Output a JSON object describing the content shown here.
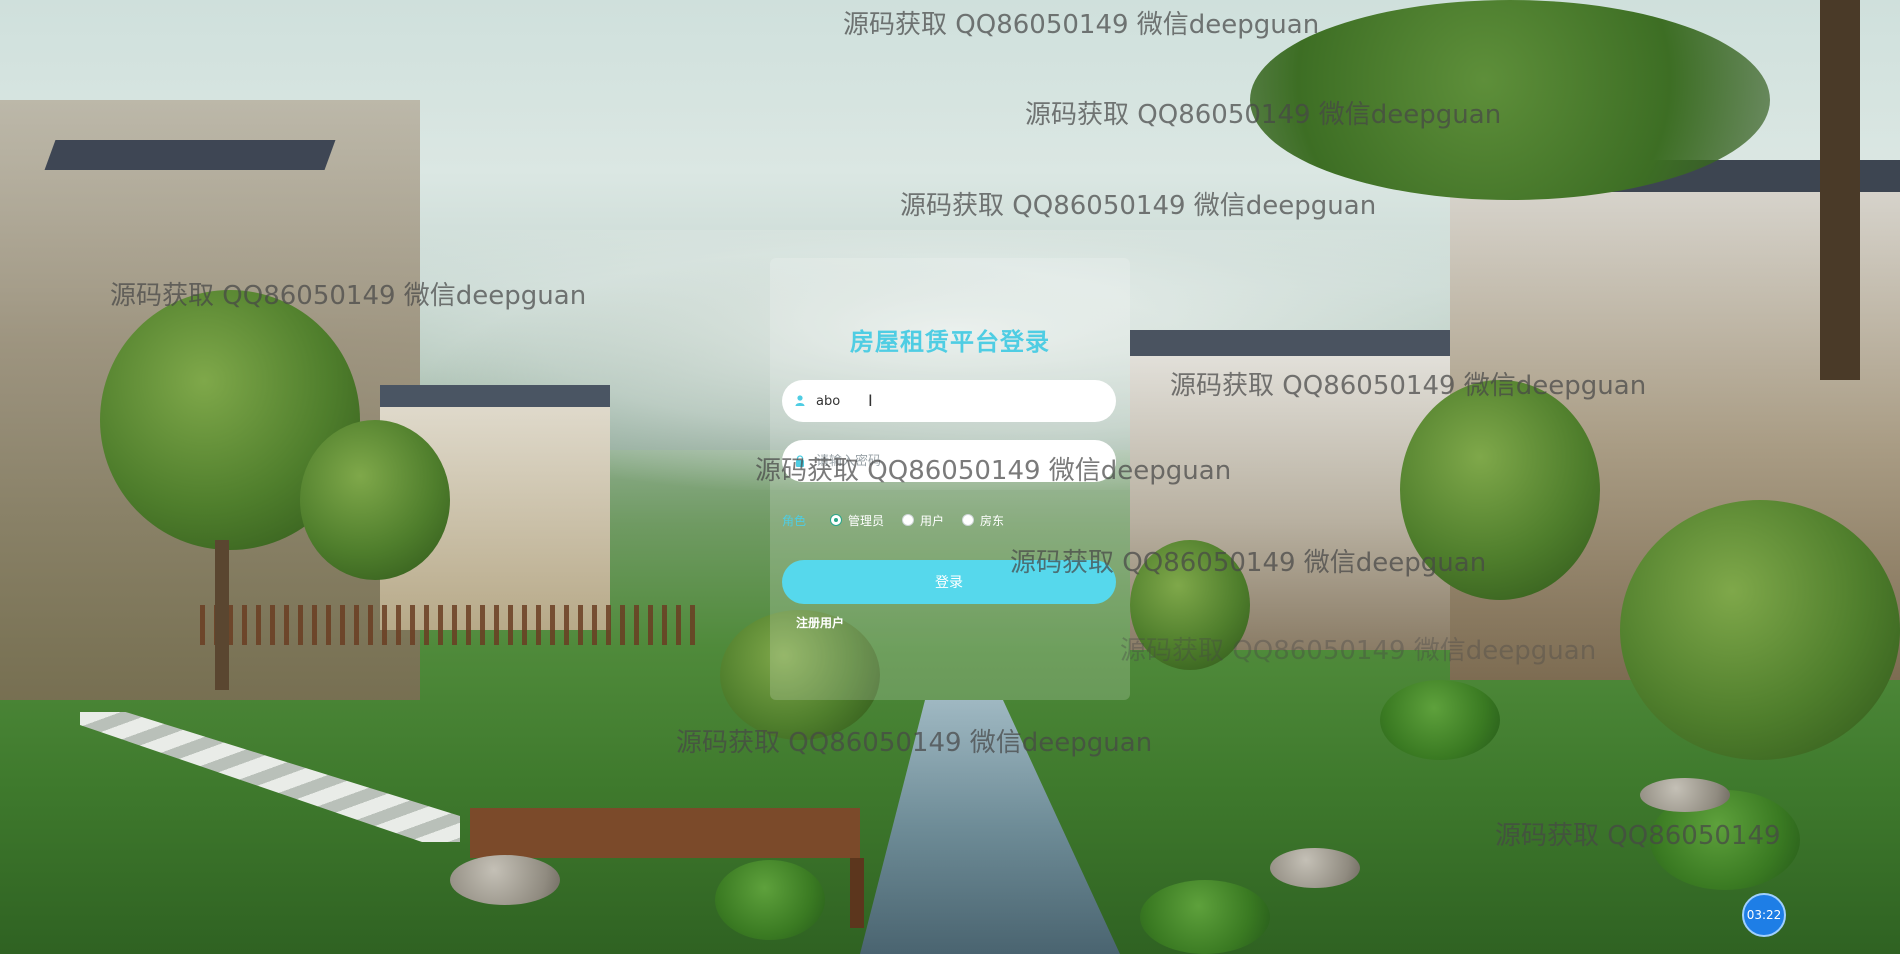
{
  "login": {
    "title": "房屋租赁平台登录",
    "username_value": "abo",
    "password_placeholder": "请输入密码",
    "role_label": "角色",
    "roles": [
      "管理员",
      "用户",
      "房东"
    ],
    "selected_role": "管理员",
    "submit_label": "登录",
    "register_label": "注册用户"
  },
  "watermarks": [
    "源码获取 QQ86050149 微信deepguan",
    "源码获取 QQ86050149 微信deepguan",
    "源码获取 QQ86050149 微信deepguan",
    "源码获取 QQ86050149 微信deepguan",
    "源码获取 QQ86050149 微信deepguan",
    "源码获取 QQ86050149 微信deepguan",
    "源码获取 QQ86050149 微信deepguan",
    "源码获取 QQ86050149 微信deepguan",
    "源码获取 QQ86050149 微信deepguan",
    "源码获取 QQ86050149"
  ],
  "timer": {
    "label": "03:22"
  },
  "icons": {
    "user": "user-icon",
    "lock": "lock-icon"
  },
  "colors": {
    "accent": "#4fcde3",
    "button": "#56d8ec",
    "radio_checked": "#2aa78a",
    "timer_badge": "#1e7ee6"
  }
}
